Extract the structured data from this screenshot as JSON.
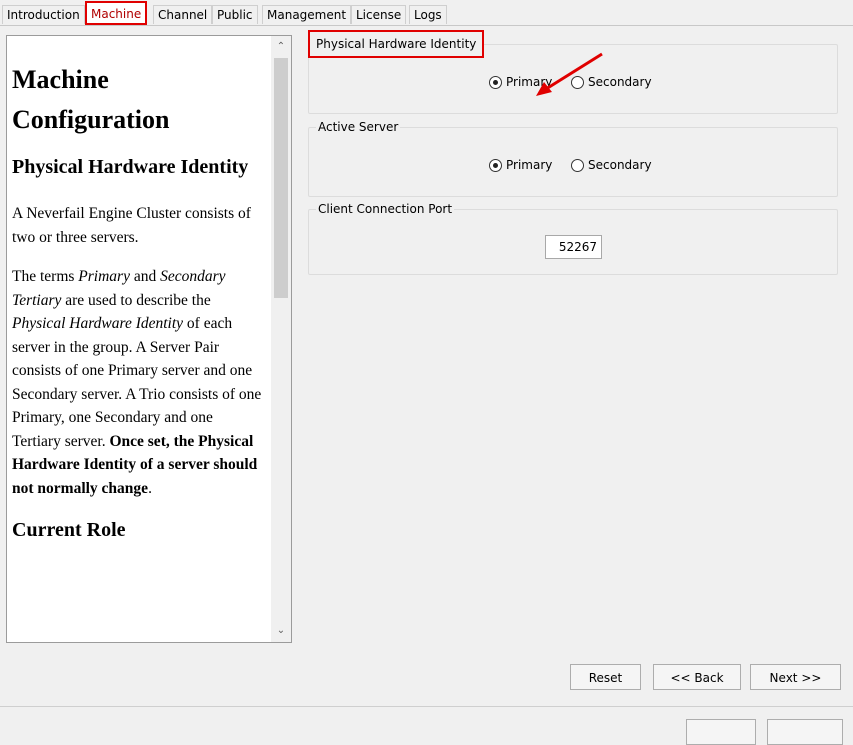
{
  "tabs": [
    {
      "label": "Introduction",
      "active": false
    },
    {
      "label": "Machine",
      "active": true
    },
    {
      "label": "Channel",
      "active": false
    },
    {
      "label": "Public",
      "active": false
    },
    {
      "label": "Management",
      "active": false
    },
    {
      "label": "License",
      "active": false
    },
    {
      "label": "Logs",
      "active": false
    }
  ],
  "help": {
    "title": "Machine Configuration",
    "section1_heading": "Physical Hardware Identity",
    "para1": "A Neverfail Engine Cluster consists of two or three servers.",
    "para2_a": "The terms ",
    "para2_primary": "Primary",
    "para2_b": " and ",
    "para2_secondary": "Secondary",
    "para2_tertiary": "Tertiary",
    "para2_c": " are used to describe the ",
    "para2_phi": "Physical Hardware Identity",
    "para2_d": " of each server in the group. A Server Pair consists of one Primary server and one Secondary server. A Trio consists of one Primary, one Secondary and one Tertiary server. ",
    "para2_bold": "Once set, the Physical Hardware Identity of a server should not normally change",
    "para2_end": ".",
    "section2_heading": "Current Role"
  },
  "groups": {
    "physical_identity": {
      "title": "Physical Hardware Identity",
      "options": [
        {
          "label": "Primary",
          "checked": true
        },
        {
          "label": "Secondary",
          "checked": false
        }
      ]
    },
    "active_server": {
      "title": "Active Server",
      "options": [
        {
          "label": "Primary",
          "checked": true
        },
        {
          "label": "Secondary",
          "checked": false
        }
      ]
    },
    "client_port": {
      "title": "Client Connection Port",
      "value": "52267"
    }
  },
  "buttons": {
    "reset": "Reset",
    "back": "<< Back",
    "next": "Next >>"
  },
  "colors": {
    "highlight": "#e00000",
    "active_tab_text": "#b00000"
  }
}
